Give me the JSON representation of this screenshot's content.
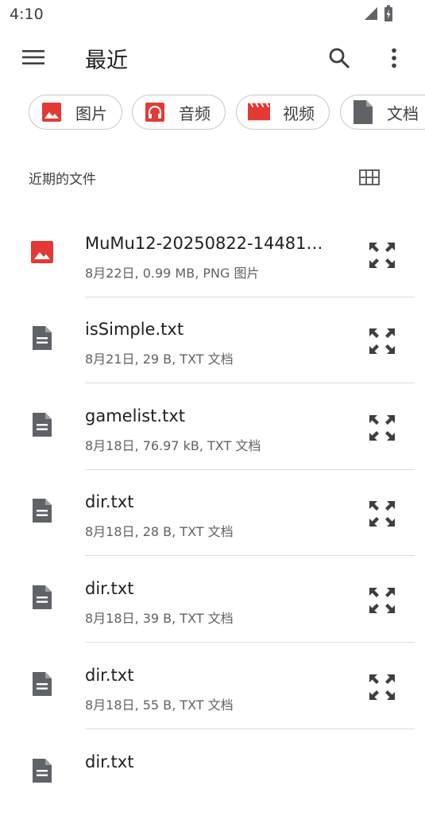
{
  "status": {
    "time": "4:10"
  },
  "appbar": {
    "title": "最近"
  },
  "chips": [
    {
      "label": "图片",
      "icon": "image-icon"
    },
    {
      "label": "音频",
      "icon": "headphones-icon"
    },
    {
      "label": "视频",
      "icon": "movie-icon"
    },
    {
      "label": "文档",
      "icon": "document-icon"
    }
  ],
  "section": {
    "label": "近期的文件"
  },
  "files": [
    {
      "name": "MuMu12-20250822-14481…",
      "meta": "8月22日, 0.99 MB, PNG 图片",
      "icon": "image-file-icon"
    },
    {
      "name": "isSimple.txt",
      "meta": "8月21日, 29 B, TXT 文档",
      "icon": "text-file-icon"
    },
    {
      "name": "gamelist.txt",
      "meta": "8月18日, 76.97 kB, TXT 文档",
      "icon": "text-file-icon"
    },
    {
      "name": "dir.txt",
      "meta": "8月18日, 28 B, TXT 文档",
      "icon": "text-file-icon"
    },
    {
      "name": "dir.txt",
      "meta": "8月18日, 39 B, TXT 文档",
      "icon": "text-file-icon"
    },
    {
      "name": "dir.txt",
      "meta": "8月18日, 55 B, TXT 文档",
      "icon": "text-file-icon"
    },
    {
      "name": "dir.txt",
      "meta": "",
      "icon": "text-file-icon"
    }
  ],
  "colors": {
    "accent_red": "#e53935",
    "icon_gray": "#5f6368",
    "divider": "#dadce0"
  }
}
